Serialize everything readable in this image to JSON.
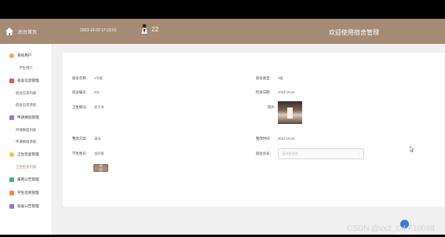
{
  "brand": {
    "title": "后台首页"
  },
  "sidebar": {
    "groups": [
      {
        "label": "系统用户",
        "icon": "settings-icon",
        "color": "#f2a65a",
        "items": [
          "学生用户"
        ]
      },
      {
        "label": "宿舍信息管理",
        "icon": "grid-icon",
        "color": "#e05c5c",
        "items": [
          "宿舍信息列表",
          "宿舍信息添加"
        ]
      },
      {
        "label": "申请换宿管理",
        "icon": "apply-icon",
        "color": "#a370d9",
        "items": [
          "申请换宿列表",
          "申请换宿添加"
        ]
      },
      {
        "label": "卫生检查管理",
        "icon": "check-icon",
        "color": "#f5c242",
        "items": [
          "卫生检查列表"
        ]
      },
      {
        "label": "报到公告管理",
        "icon": "notice-icon",
        "color": "#3fb37f",
        "items": []
      },
      {
        "label": "学生签到管理",
        "icon": "signin-icon",
        "color": "#f08c3a",
        "items": []
      },
      {
        "label": "宿舍公告管理",
        "icon": "announce-icon",
        "color": "#9b6fd6",
        "items": []
      }
    ],
    "active_item": "卫生检查列表"
  },
  "topbar": {
    "time": "2023-10-23 17:13:01",
    "username": "22",
    "title": "欢迎使用宿舍管理"
  },
  "form": {
    "dorm_name": {
      "label": "宿舍名称:",
      "value": "1号楼"
    },
    "dorm_type": {
      "label": "宿舍类型:",
      "value": "3楼"
    },
    "dorm_no": {
      "label": "宿舍编号:",
      "value": "001"
    },
    "check_date": {
      "label": "检查日期:",
      "value": "2023-10-23"
    },
    "hygiene": {
      "label": "卫生情况:",
      "value": "很干净"
    },
    "photo": {
      "label": "照片:"
    },
    "rectify_plan": {
      "label": "整改方案:",
      "value": "清洁"
    },
    "rectify_time": {
      "label": "整改时间:",
      "value": "2023-10-24"
    },
    "student_name": {
      "label": "学生姓名:",
      "value": "张四哥"
    },
    "dorm_leader": {
      "label": "宿舍舍长:",
      "placeholder": "请选择宿舍"
    },
    "back_button": "返回"
  },
  "watermark": "CSDN @vx2_C4 F10088",
  "colors": {
    "accent": "#a58b73",
    "sidebar_bg": "#ffffff",
    "page_bg": "#f0f0f0"
  }
}
